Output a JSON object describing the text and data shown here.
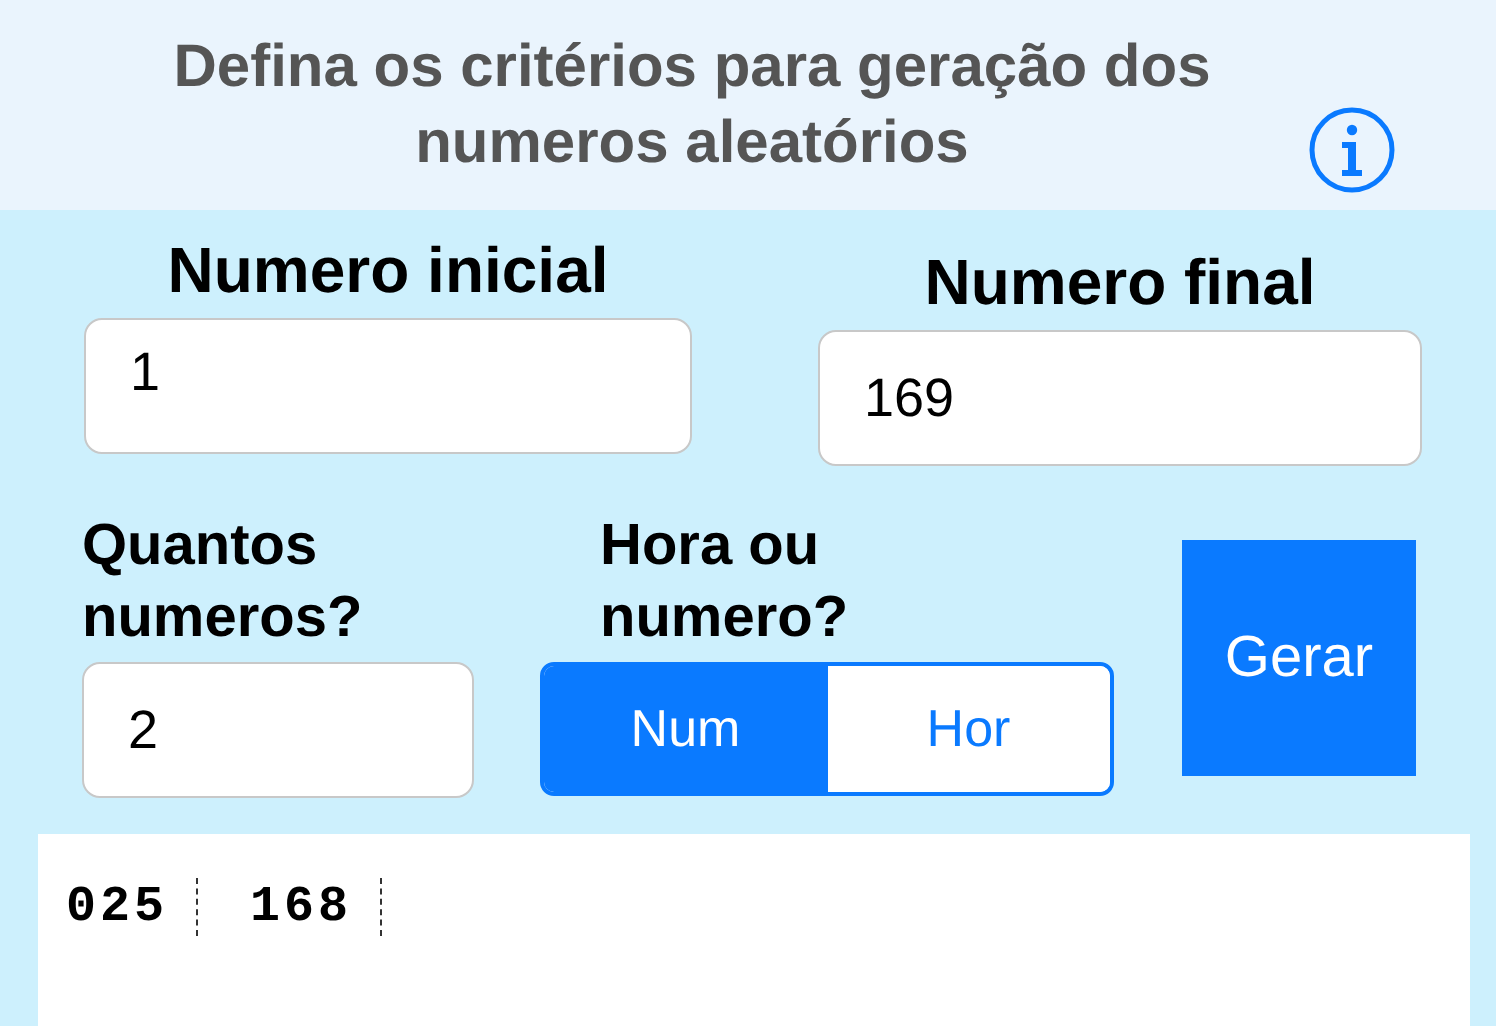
{
  "header": {
    "title": "Defina os critérios para geração dos numeros aleatórios"
  },
  "start": {
    "label": "Numero inicial",
    "value": "1"
  },
  "end": {
    "label": "Numero final",
    "value": "169"
  },
  "count": {
    "label": "Quantos numeros?",
    "value": "2"
  },
  "mode": {
    "label": "Hora ou numero?",
    "segments": [
      {
        "label": "Num",
        "selected": true
      },
      {
        "label": "Hor",
        "selected": false
      }
    ]
  },
  "generate_button": {
    "label": "Gerar"
  },
  "results": [
    "025",
    "168"
  ]
}
